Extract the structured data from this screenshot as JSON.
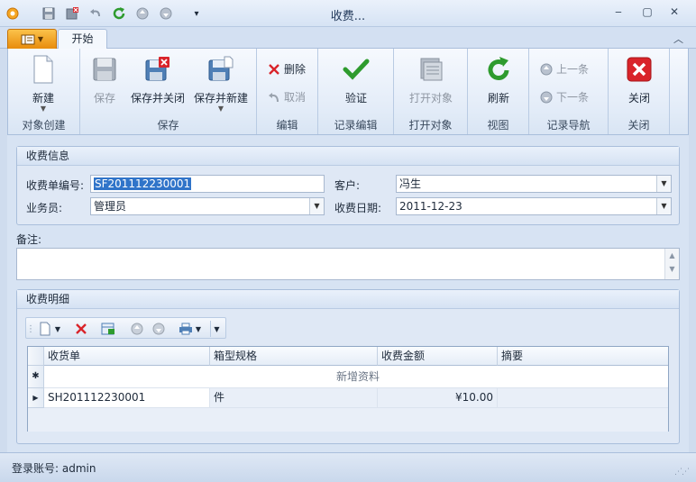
{
  "window": {
    "title": "收费...",
    "controls": {
      "minimize": "‒",
      "maximize": "▢",
      "close": "✕"
    }
  },
  "ribbon": {
    "tabs": [
      {
        "label": "开始",
        "active": true
      }
    ],
    "groups": {
      "create": {
        "label": "对象创建",
        "new_label": "新建"
      },
      "save": {
        "label": "保存",
        "save_label": "保存",
        "save_close_label": "保存并关闭",
        "save_new_label": "保存并新建"
      },
      "edit": {
        "label": "编辑",
        "delete_label": "删除",
        "cancel_label": "取消"
      },
      "record_edit": {
        "label": "记录编辑",
        "validate_label": "验证"
      },
      "open": {
        "label": "打开对象",
        "open_label": "打开对象"
      },
      "view": {
        "label": "视图",
        "refresh_label": "刷新"
      },
      "nav": {
        "label": "记录导航",
        "prev_label": "上一条",
        "next_label": "下一条"
      },
      "close": {
        "label": "关闭",
        "close_label": "关闭"
      }
    }
  },
  "info": {
    "section_title": "收费信息",
    "fields": {
      "receipt_no": {
        "label": "收费单编号:",
        "value": "SF201112230001"
      },
      "customer": {
        "label": "客户:",
        "value": "冯生"
      },
      "salesman": {
        "label": "业务员:",
        "value": "管理员"
      },
      "date": {
        "label": "收费日期:",
        "value": "2011-12-23"
      }
    }
  },
  "remark": {
    "label": "备注:",
    "value": ""
  },
  "detail": {
    "section_title": "收费明细",
    "columns": [
      "收货单",
      "箱型规格",
      "收费金额",
      "摘要"
    ],
    "new_row_label": "新增资料",
    "rows": [
      {
        "receipt": "SH201112230001",
        "spec": "件",
        "amount": "¥10.00",
        "summary": ""
      }
    ]
  },
  "status": {
    "text": "登录账号: admin"
  },
  "colors": {
    "accent": "#e88c0c",
    "selection": "#3074c9",
    "panel_bg": "#dfe8f5",
    "danger": "#d9242a",
    "ok": "#2e9b2e"
  }
}
